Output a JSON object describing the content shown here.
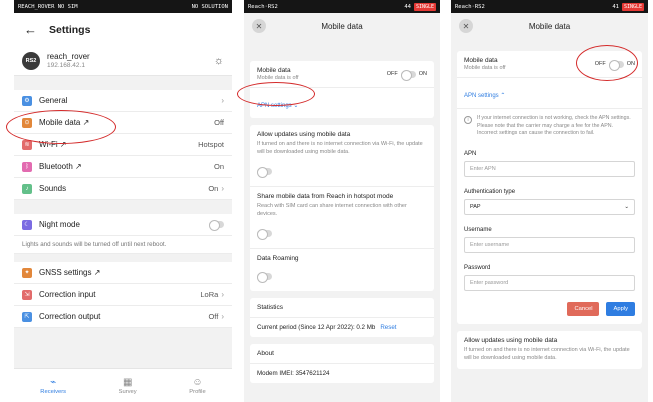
{
  "screen1": {
    "status_left": "REACH_ROVER  NO SIM",
    "status_right": "NO SOLUTION",
    "title": "Settings",
    "device": {
      "avatar": "RS2",
      "name": "reach_rover",
      "ip": "192.168.42.1"
    },
    "rows": [
      {
        "label": "General",
        "value": "",
        "icon": "gear-icon",
        "color": "#4a90e2"
      },
      {
        "label": "Mobile data ↗",
        "value": "Off",
        "icon": "antenna-icon",
        "color": "#e2873a"
      },
      {
        "label": "Wi-Fi ↗",
        "value": "Hotspot",
        "icon": "wifi-icon",
        "color": "#e26b6b"
      },
      {
        "label": "Bluetooth ↗",
        "value": "On",
        "icon": "bluetooth-icon",
        "color": "#e26bb0"
      },
      {
        "label": "Sounds",
        "value": "On",
        "icon": "sound-icon",
        "color": "#63c08a"
      }
    ],
    "night_mode": {
      "label": "Night mode",
      "note": "Lights and sounds will be turned off until next reboot."
    },
    "rows2": [
      {
        "label": "GNSS settings ↗",
        "value": ""
      },
      {
        "label": "Correction input",
        "value": "LoRa"
      },
      {
        "label": "Correction output",
        "value": "Off"
      }
    ],
    "nav": [
      {
        "label": "Receivers",
        "icon": "antenna-icon"
      },
      {
        "label": "Survey",
        "icon": "map-icon"
      },
      {
        "label": "Profile",
        "icon": "person-icon"
      }
    ]
  },
  "screen2": {
    "status_left": "Reach·RS2",
    "status_right_num": "44",
    "badge": "SINGLE",
    "title": "Mobile data",
    "mobile_data": {
      "title": "Mobile data",
      "sub": "Mobile data is off",
      "off": "OFF",
      "on": "ON"
    },
    "apn_link": "APN settings ⌄",
    "allow_updates": {
      "title": "Allow updates using mobile data",
      "text": "If turned on and there is no internet connection via Wi-Fi, the update will be downloaded using mobile data."
    },
    "share": {
      "title": "Share mobile data from Reach in hotspot mode",
      "text": "Reach with SIM card can share internet connection with other devices."
    },
    "roaming": {
      "title": "Data Roaming"
    },
    "statistics": {
      "title": "Statistics",
      "period": "Current period (Since 12 Apr 2022): 0.2 Mb",
      "reset": "Reset"
    },
    "about": {
      "title": "About",
      "imei": "Modem IMEI: 3547621124"
    }
  },
  "screen3": {
    "status_left": "Reach·RS2",
    "status_right_num": "41",
    "badge": "SINGLE",
    "title": "Mobile data",
    "mobile_data": {
      "title": "Mobile data",
      "sub": "Mobile data is off",
      "off": "OFF",
      "on": "ON"
    },
    "apn_link": "APN settings ⌃",
    "info": "If your internet connection is not working, check the APN settings. Please note that the carrier may charge a fee for the APN. Incorrect settings can cause the connection to fail.",
    "apn": {
      "label": "APN",
      "placeholder": "Enter APN"
    },
    "auth": {
      "label": "Authentication type",
      "value": "PAP"
    },
    "username": {
      "label": "Username",
      "placeholder": "Enter username"
    },
    "password": {
      "label": "Password",
      "placeholder": "Enter password"
    },
    "cancel": "Cancel",
    "apply": "Apply",
    "allow_updates": {
      "title": "Allow updates using mobile data",
      "text": "If turned on and there is no internet connection via Wi-Fi, the update will be downloaded using mobile data."
    }
  }
}
